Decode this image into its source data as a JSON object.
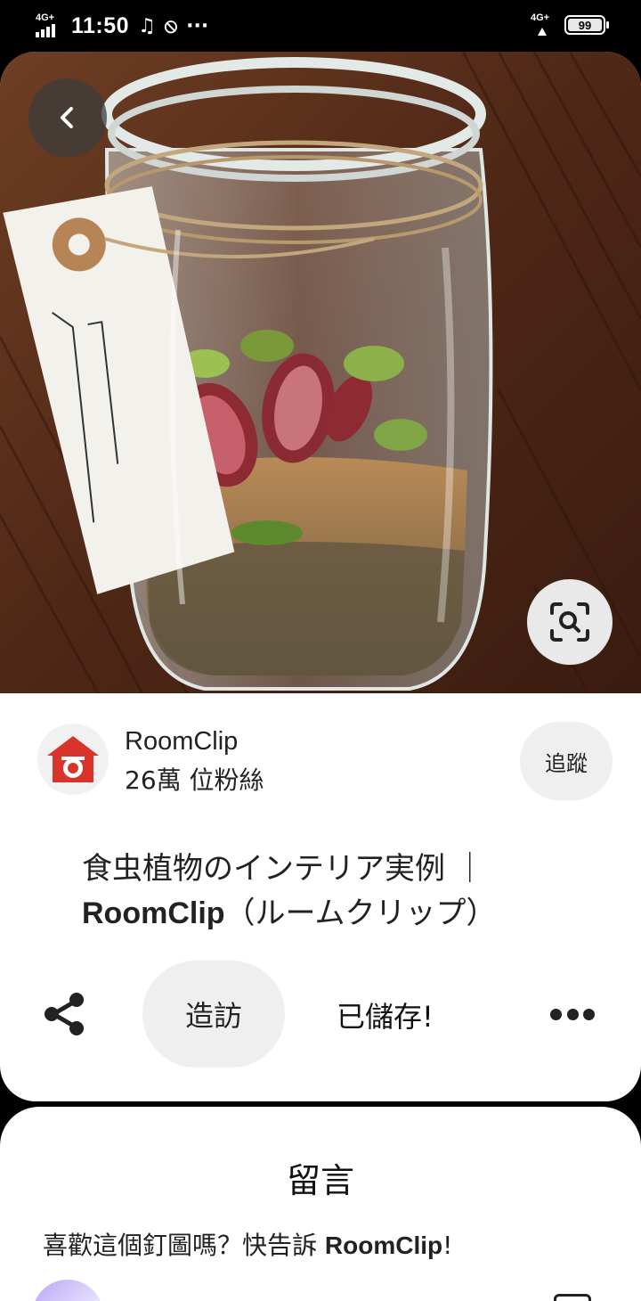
{
  "status_bar": {
    "network_left": "4G+",
    "time": "11:50",
    "music_icon": "music-note-icon",
    "sim_icon": "sim-off-icon",
    "more_indicator": "···",
    "network_right": "4G+",
    "battery": "99"
  },
  "pin": {
    "back_icon": "chevron-left-icon",
    "lens_icon": "visual-search-icon",
    "creator": {
      "name": "RoomClip",
      "followers": "26萬 位粉絲",
      "follow_label": "追蹤"
    },
    "title_line1": "食虫植物のインテリア実例 ｜",
    "title_line2_bold": "RoomClip",
    "title_line2_rest": "（ルームクリップ）",
    "actions": {
      "share_icon": "share-icon",
      "visit_label": "造訪",
      "saved_label": "已儲存!",
      "more_icon": "more-dots-icon"
    }
  },
  "comments": {
    "heading": "留言",
    "prompt_prefix": "喜歡這個釘圖嗎？快告訴 ",
    "prompt_name": "RoomClip",
    "prompt_suffix": "!"
  },
  "colors": {
    "brand_red": "#d9342b",
    "button_gray": "#efefef",
    "text": "#222222"
  }
}
